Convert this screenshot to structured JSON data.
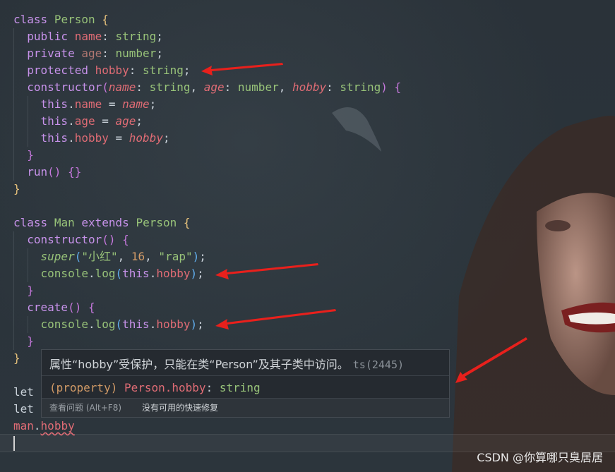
{
  "code": {
    "line1": {
      "kw": "class",
      "name": "Person",
      "open": "{"
    },
    "line2": {
      "mod": "public",
      "prop": "name",
      "type": "string"
    },
    "line3": {
      "mod": "private",
      "prop": "age",
      "type": "number"
    },
    "line4": {
      "mod": "protected",
      "prop": "hobby",
      "type": "string"
    },
    "line5": {
      "kw": "constructor",
      "p1": "name",
      "t1": "string",
      "p2": "age",
      "t2": "number",
      "p3": "hobby",
      "t3": "string"
    },
    "line6": {
      "this": "this",
      "prop": "name",
      "val": "name"
    },
    "line7": {
      "this": "this",
      "prop": "age",
      "val": "age"
    },
    "line8": {
      "this": "this",
      "prop": "hobby",
      "val": "hobby"
    },
    "line10": {
      "fn": "run"
    },
    "line13": {
      "kw": "class",
      "name": "Man",
      "ext": "extends",
      "base": "Person"
    },
    "line14": {
      "kw": "constructor"
    },
    "line15": {
      "fn": "super",
      "s1": "\"小红\"",
      "n": "16",
      "s2": "\"rap\""
    },
    "line16": {
      "obj": "console",
      "fn": "log",
      "this": "this",
      "prop": "hobby"
    },
    "line18": {
      "fn": "create"
    },
    "line19": {
      "obj": "console",
      "fn": "log",
      "this": "this",
      "prop": "hobby"
    },
    "line22": {
      "kw": "let"
    },
    "line23": {
      "kw": "let"
    },
    "line24": {
      "obj": "man",
      "prop": "hobby"
    }
  },
  "hover": {
    "message": "属性“hobby”受保护，只能在类“Person”及其子类中访问。",
    "code": "ts(2445)",
    "sig_kind": "(property)",
    "sig_name": "Person.hobby",
    "sig_type": "string",
    "view_problem": "查看问题 (Alt+F8)",
    "no_quick_fix": "没有可用的快速修复"
  },
  "watermark": "CSDN @你算哪只臭居居",
  "colors": {
    "arrow": "#e8201c",
    "keyword": "#c792ea",
    "class": "#98c379",
    "property": "#e06c75"
  }
}
